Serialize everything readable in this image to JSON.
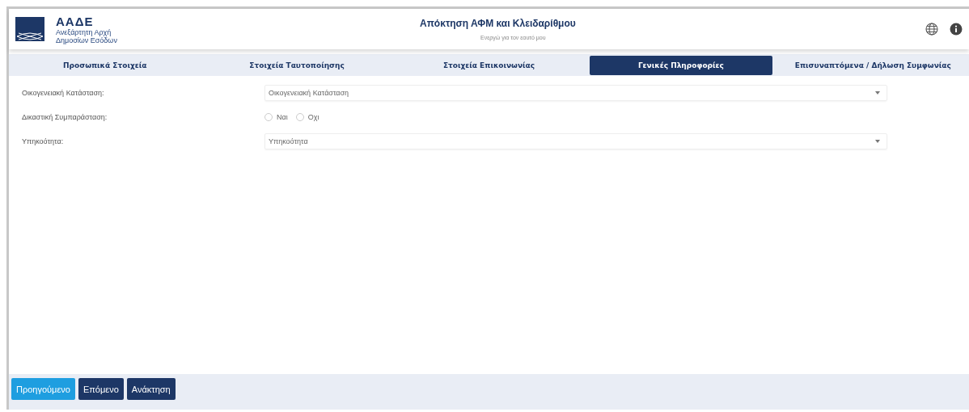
{
  "header": {
    "logo_title": "ΑΑΔΕ",
    "logo_subtitle_1": "Ανεξάρτητη Αρχή",
    "logo_subtitle_2": "Δημοσίων Εσόδων",
    "title": "Απόκτηση ΑΦΜ και Κλειδαρίθμου",
    "subtitle": "Ενεργώ για τον εαυτό μου"
  },
  "tabs": [
    {
      "label": "Προσωπικά Στοιχεία",
      "selected": false
    },
    {
      "label": "Στοιχεία Ταυτοποίησης",
      "selected": false
    },
    {
      "label": "Στοιχεία Επικοινωνίας",
      "selected": false
    },
    {
      "label": "Γενικές Πληροφορίες",
      "selected": true
    },
    {
      "label": "Επισυναπτόμενα / Δήλωση Συμφωνίας",
      "selected": false
    }
  ],
  "fields": [
    {
      "kind": "select",
      "label": "Οικογενειακή Κατάσταση:",
      "placeholder": "Οικογενειακή Κατάσταση"
    },
    {
      "kind": "radio",
      "label": "Δικαστική Συμπαράσταση:",
      "options": [
        {
          "label": "Ναι",
          "selected": false
        },
        {
          "label": "Οχι",
          "selected": false
        }
      ]
    },
    {
      "kind": "select",
      "label": "Υπηκοότητα:",
      "placeholder": "Υπηκοότητα"
    }
  ],
  "buttons": [
    {
      "label": "Προηγούμενο",
      "kind": "secondary"
    },
    {
      "label": "Επόμενο",
      "kind": "primary"
    },
    {
      "label": "Ανάκτηση",
      "kind": "primary"
    }
  ]
}
